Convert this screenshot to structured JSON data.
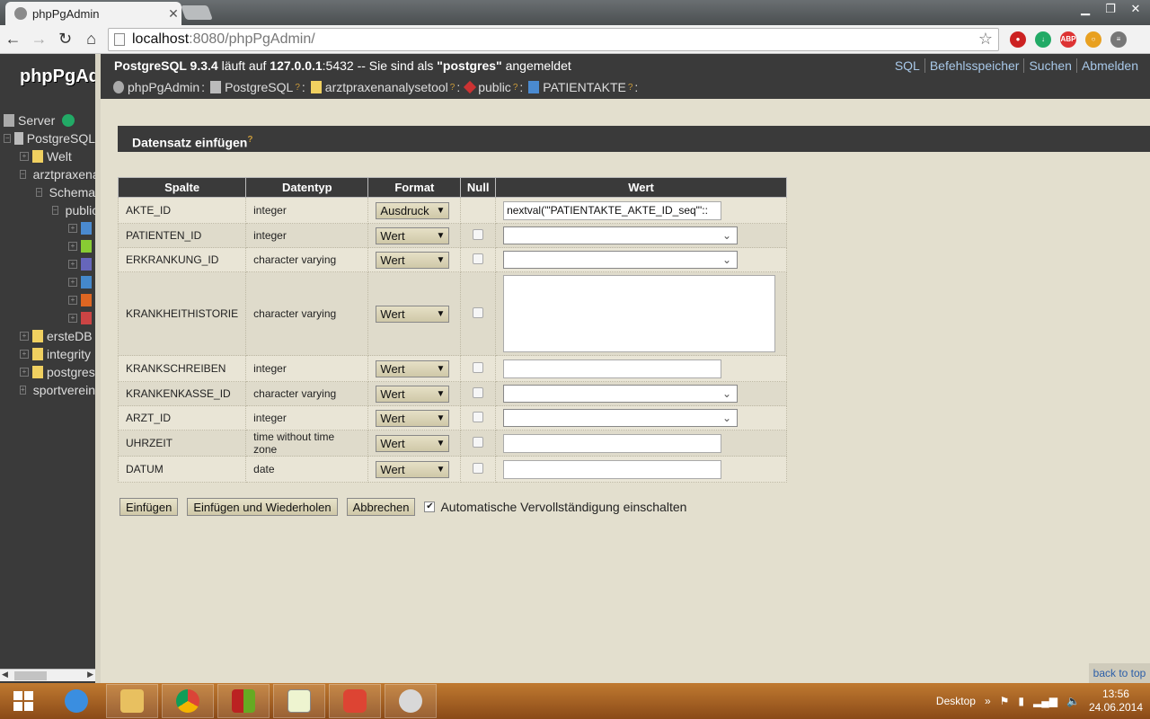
{
  "browser": {
    "tab_title": "phpPgAdmin",
    "url_host": "localhost",
    "url_rest": ":8080/phpPgAdmin/"
  },
  "tree": {
    "logo": "phpPgAdmin",
    "items": [
      {
        "label": "Server"
      },
      {
        "label": "PostgreSQL"
      },
      {
        "label": "Welt"
      },
      {
        "label": "arztpraxenanalysetool"
      },
      {
        "label": "Schemas"
      },
      {
        "label": "public"
      },
      {
        "label": ""
      },
      {
        "label": ""
      },
      {
        "label": ""
      },
      {
        "label": ""
      },
      {
        "label": ""
      },
      {
        "label": ""
      },
      {
        "label": "ersteDB"
      },
      {
        "label": "integrity"
      },
      {
        "label": "postgres"
      },
      {
        "label": "sportverein"
      }
    ]
  },
  "topbar": {
    "version": "PostgreSQL 9.3.4",
    "runs_on": " läuft auf ",
    "host": "127.0.0.1",
    "port": ":5432 -- Sie sind als ",
    "user": "\"postgres\"",
    "logged_in": " angemeldet",
    "links": [
      "SQL",
      "Befehlsspeicher",
      "Suchen",
      "Abmelden"
    ],
    "trail": [
      "phpPgAdmin",
      "PostgreSQL",
      "arztpraxenanalysetool",
      "public",
      "PATIENTAKTE"
    ],
    "help": "?",
    "sep": ":"
  },
  "section": {
    "title": "Datensatz einfügen"
  },
  "table": {
    "headers": {
      "spalte": "Spalte",
      "datentyp": "Datentyp",
      "format": "Format",
      "null": "Null",
      "wert": "Wert"
    },
    "rows": [
      {
        "spalte": "AKTE_ID",
        "datentyp": "integer",
        "format": "Ausdruck",
        "value": "nextval('\"PATIENTAKTE_AKTE_ID_seq\"'::"
      },
      {
        "spalte": "PATIENTEN_ID",
        "datentyp": "integer",
        "format": "Wert",
        "value": ""
      },
      {
        "spalte": "ERKRANKUNG_ID",
        "datentyp": "character varying",
        "format": "Wert",
        "value": ""
      },
      {
        "spalte": "KRANKHEITHISTORIE",
        "datentyp": "character varying",
        "format": "Wert",
        "value": ""
      },
      {
        "spalte": "KRANKSCHREIBEN",
        "datentyp": "integer",
        "format": "Wert",
        "value": ""
      },
      {
        "spalte": "KRANKENKASSE_ID",
        "datentyp": "character varying",
        "format": "Wert",
        "value": ""
      },
      {
        "spalte": "ARZT_ID",
        "datentyp": "integer",
        "format": "Wert",
        "value": ""
      },
      {
        "spalte": "UHRZEIT",
        "datentyp": "time without time zone",
        "format": "Wert",
        "value": ""
      },
      {
        "spalte": "DATUM",
        "datentyp": "date",
        "format": "Wert",
        "value": ""
      }
    ]
  },
  "actions": {
    "insert": "Einfügen",
    "insert_repeat": "Einfügen und Wiederholen",
    "cancel": "Abbrechen",
    "autocomplete": "Automatische Vervollständigung einschalten"
  },
  "back_to_top": "back to top",
  "taskbar": {
    "desktop": "Desktop",
    "time": "13:56",
    "date": "24.06.2014"
  }
}
